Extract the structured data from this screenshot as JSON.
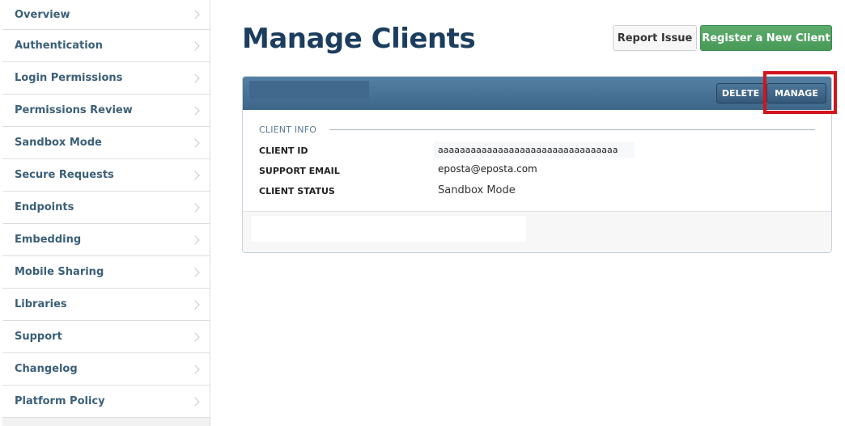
{
  "sidebar": {
    "items": [
      {
        "label": "Overview"
      },
      {
        "label": "Authentication"
      },
      {
        "label": "Login Permissions"
      },
      {
        "label": "Permissions Review"
      },
      {
        "label": "Sandbox Mode"
      },
      {
        "label": "Secure Requests"
      },
      {
        "label": "Endpoints"
      },
      {
        "label": "Embedding"
      },
      {
        "label": "Mobile Sharing"
      },
      {
        "label": "Libraries"
      },
      {
        "label": "Support"
      },
      {
        "label": "Changelog"
      },
      {
        "label": "Platform Policy"
      }
    ]
  },
  "header": {
    "title": "Manage Clients",
    "report_issue_label": "Report Issue",
    "register_label": "Register a New Client"
  },
  "client_panel": {
    "delete_label": "DELETE",
    "manage_label": "MANAGE",
    "section_title": "CLIENT INFO",
    "rows": [
      {
        "label": "CLIENT ID",
        "value": "aaaaaaaaaaaaaaaaaaaaaaaaaaaaaaaaa"
      },
      {
        "label": "SUPPORT EMAIL",
        "value": "eposta@eposta.com"
      },
      {
        "label": "CLIENT STATUS",
        "value": "Sandbox Mode"
      }
    ]
  },
  "colors": {
    "accent_blue": "#3d6689",
    "title_navy": "#1c3d5e",
    "register_green": "#489a58",
    "highlight_red": "#d2141c"
  }
}
